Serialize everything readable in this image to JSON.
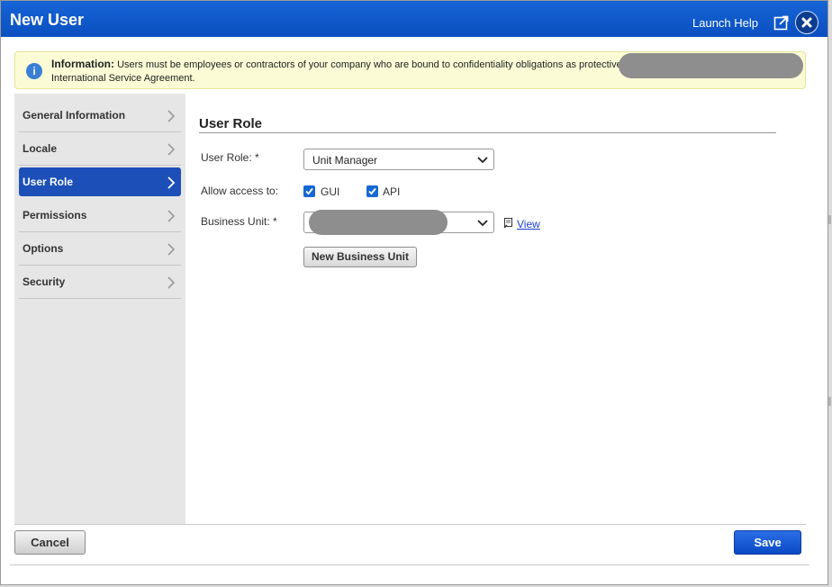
{
  "dialog": {
    "title": "New User",
    "launch_help": "Launch Help",
    "popout_icon": "popout-icon",
    "close_icon": "close-icon",
    "accent_color": "#0a4fc0"
  },
  "info": {
    "label": "Information:",
    "message": "Users must be employees or contractors of your company who are bound to confidentiality obligations as protective",
    "message_line2": "International Service Agreement.",
    "icon": "info-icon"
  },
  "sidebar": {
    "items": [
      {
        "label": "General Information"
      },
      {
        "label": "Locale"
      },
      {
        "label": "User Role",
        "active": true
      },
      {
        "label": "Permissions"
      },
      {
        "label": "Options"
      },
      {
        "label": "Security"
      }
    ]
  },
  "user_role": {
    "section_title": "User Role",
    "role_label": "User Role: *",
    "role_value": "Unit Manager",
    "access_label": "Allow access to:",
    "gui_label": "GUI",
    "gui_checked": true,
    "api_label": "API",
    "api_checked": true,
    "business_unit_label": "Business Unit: *",
    "business_unit_value": "",
    "view_link": "View",
    "new_bu_button": "New Business Unit"
  },
  "footer": {
    "cancel": "Cancel",
    "save": "Save"
  }
}
